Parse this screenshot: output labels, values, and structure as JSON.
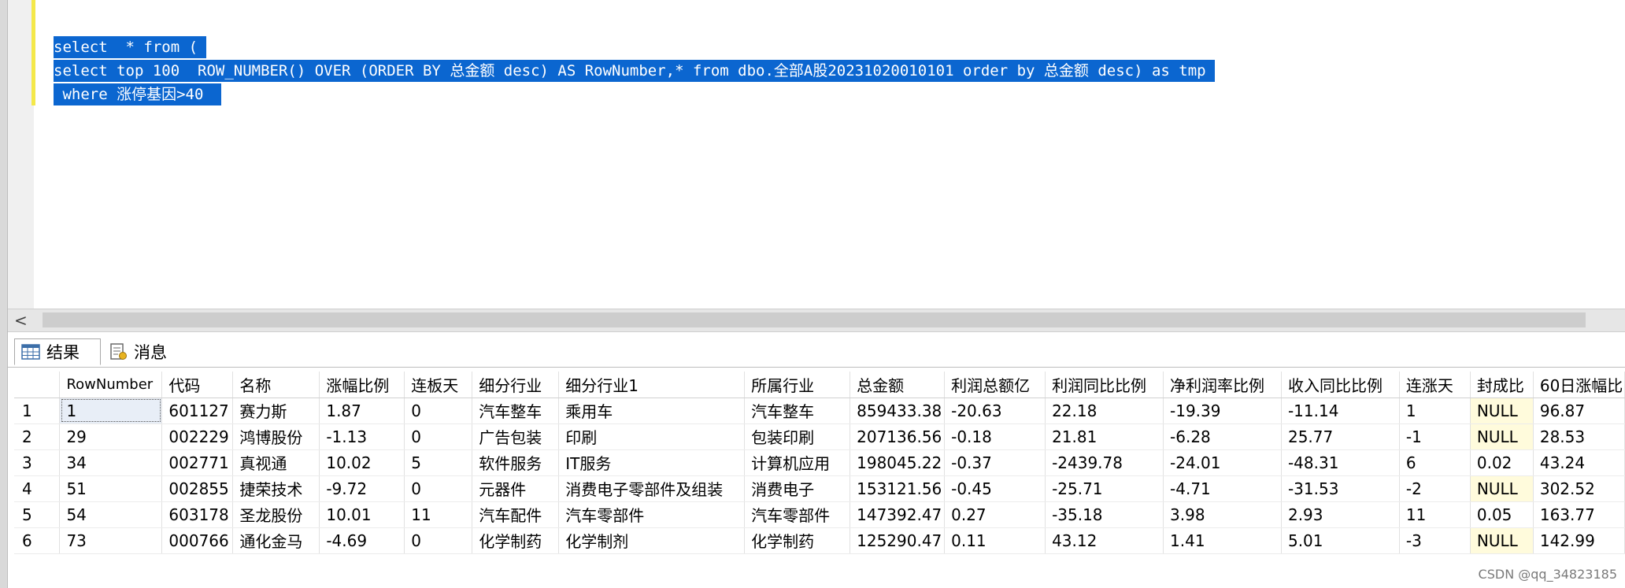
{
  "editor": {
    "lines": [
      "select  * from ( ",
      "select top 100  ROW_NUMBER() OVER (ORDER BY 总金额 desc) AS RowNumber,* from dbo.全部A股20231020010101 order by 总金额 desc) as tmp ",
      " where 涨停基因>40  "
    ],
    "selection_color": "#0b66d0"
  },
  "hscroll": {
    "left_arrow": "<"
  },
  "tabs": [
    {
      "label": "结果",
      "icon": "grid-results-icon",
      "active": true
    },
    {
      "label": "消息",
      "icon": "messages-icon",
      "active": false
    }
  ],
  "table": {
    "columns": [
      "",
      "RowNumber",
      "代码",
      "名称",
      "涨幅比例",
      "连板天",
      "细分行业",
      "细分行业1",
      "所属行业",
      "总金额",
      "利润总额亿",
      "利润同比比例",
      "净利润率比例",
      "收入同比比例",
      "连涨天",
      "封成比",
      "60日涨幅比"
    ],
    "rows": [
      [
        "1",
        "1",
        "601127",
        "赛力斯",
        "1.87",
        "0",
        "汽车整车",
        "乘用车",
        "汽车整车",
        "859433.38",
        "-20.63",
        "22.18",
        "-19.39",
        "-11.14",
        "1",
        "NULL",
        "96.87"
      ],
      [
        "2",
        "29",
        "002229",
        "鸿博股份",
        "-1.13",
        "0",
        "广告包装",
        "印刷",
        "包装印刷",
        "207136.56",
        "-0.18",
        "21.81",
        "-6.28",
        "25.77",
        "-1",
        "NULL",
        "28.53"
      ],
      [
        "3",
        "34",
        "002771",
        "真视通",
        "10.02",
        "5",
        "软件服务",
        "IT服务",
        "计算机应用",
        "198045.22",
        "-0.37",
        "-2439.78",
        "-24.01",
        "-48.31",
        "6",
        "0.02",
        "43.24"
      ],
      [
        "4",
        "51",
        "002855",
        "捷荣技术",
        "-9.72",
        "0",
        "元器件",
        "消费电子零部件及组装",
        "消费电子",
        "153121.56",
        "-0.45",
        "-25.71",
        "-4.71",
        "-31.53",
        "-2",
        "NULL",
        "302.52"
      ],
      [
        "5",
        "54",
        "603178",
        "圣龙股份",
        "10.01",
        "11",
        "汽车配件",
        "汽车零部件",
        "汽车零部件",
        "147392.47",
        "0.27",
        "-35.18",
        "3.98",
        "2.93",
        "11",
        "0.05",
        "163.77"
      ],
      [
        "6",
        "73",
        "000766",
        "通化金马",
        "-4.69",
        "0",
        "化学制药",
        "化学制剂",
        "化学制药",
        "125290.47",
        "0.11",
        "43.12",
        "1.41",
        "5.01",
        "-3",
        "NULL",
        "142.99"
      ]
    ]
  },
  "watermark": "CSDN @qq_34823185"
}
